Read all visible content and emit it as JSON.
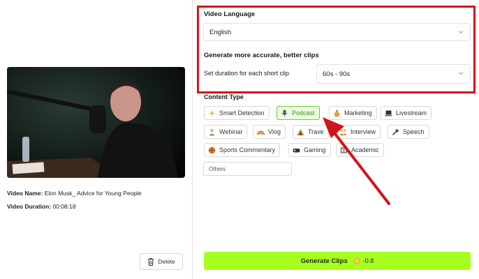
{
  "video": {
    "name_label": "Video Name:",
    "name_value": "Elon Musk_ Advice for Young People",
    "duration_label": "Video Duration:",
    "duration_value": "00:08:18"
  },
  "delete_label": "Delete",
  "language": {
    "title": "Video Language",
    "selected": "English"
  },
  "clips": {
    "title": "Generate more accurate, better clips",
    "duration_label": "Set duration for each short clip",
    "duration_selected": "60s - 90s"
  },
  "content_type": {
    "title": "Content Type",
    "chips": [
      {
        "label": "Smart Detection",
        "icon": "sparkle-icon"
      },
      {
        "label": "Podcast",
        "icon": "microphone-icon",
        "active": true
      },
      {
        "label": "Marketing",
        "icon": "money-bag-icon"
      },
      {
        "label": "Livestream",
        "icon": "laptop-icon"
      },
      {
        "label": "Webinar",
        "icon": "presenter-icon"
      },
      {
        "label": "Vlog",
        "icon": "rainbow-icon"
      },
      {
        "label": "Trave",
        "icon": "camping-icon"
      },
      {
        "label": "Interview",
        "icon": "handshake-icon"
      },
      {
        "label": "Speech",
        "icon": "mic-icon"
      },
      {
        "label": "Sports Commentary",
        "icon": "basketball-icon"
      },
      {
        "label": "Gaming",
        "icon": "gamepad-icon"
      },
      {
        "label": "Academic",
        "icon": "book-icon"
      }
    ],
    "others_placeholder": "Others"
  },
  "generate": {
    "label": "Generate Clips",
    "credit": "-0.8"
  },
  "colors": {
    "accent_green": "#a6ff1f",
    "highlight_red": "#d0141b",
    "active_chip_border": "#6dc93a"
  }
}
